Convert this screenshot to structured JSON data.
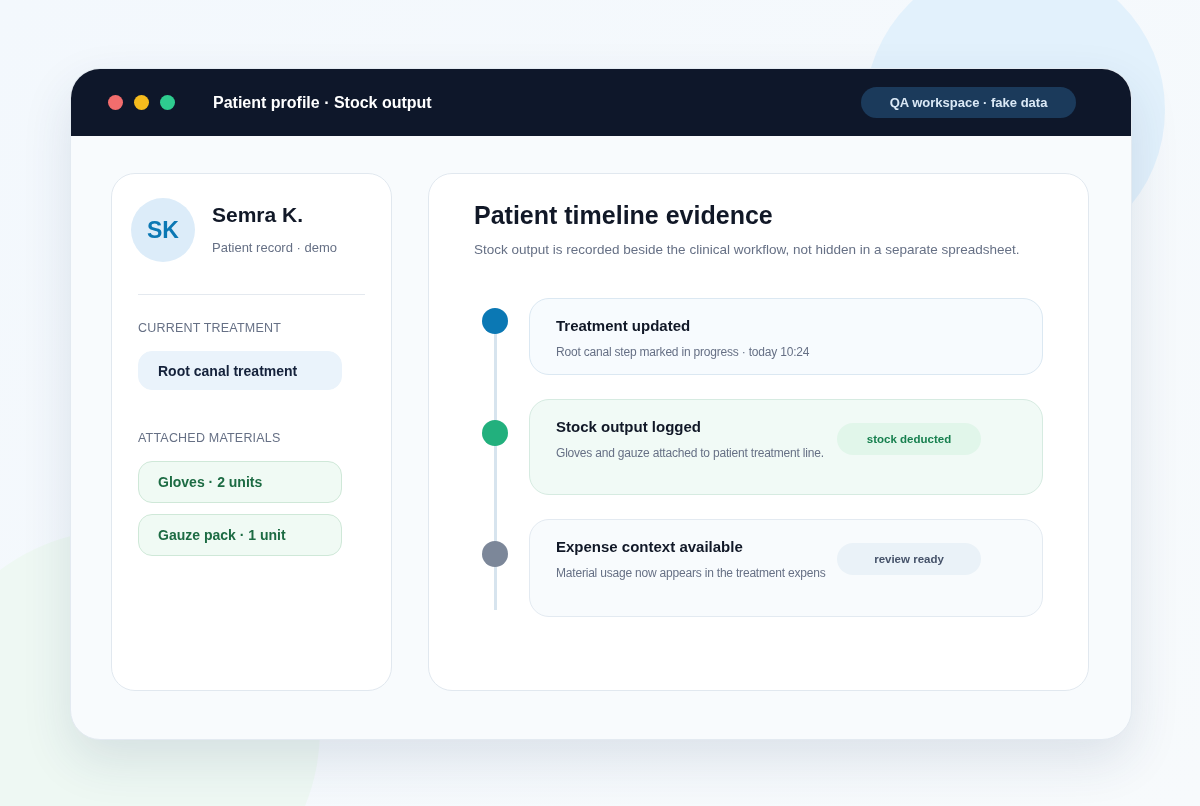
{
  "window": {
    "title": "Patient profile · Stock output",
    "badge": "QA workspace · fake data"
  },
  "patient": {
    "initials": "SK",
    "name": "Semra K.",
    "subtitle": "Patient record · demo"
  },
  "current_treatment": {
    "label": "CURRENT TREATMENT",
    "value": "Root canal treatment"
  },
  "attached_materials": {
    "label": "ATTACHED MATERIALS",
    "items": [
      "Gloves · 2 units",
      "Gauze pack · 1 unit"
    ]
  },
  "timeline": {
    "title": "Patient timeline evidence",
    "subtitle": "Stock output is recorded beside the clinical workflow, not hidden in a separate spreadsheet.",
    "events": [
      {
        "kind": "info",
        "color": "#0b78b4",
        "title": "Treatment updated",
        "text": "Root canal step marked in progress · today 10:24"
      },
      {
        "kind": "success",
        "color": "#22b07d",
        "title": "Stock output logged",
        "text": "Gloves and gauze attached to patient treatment line.",
        "badge": "stock deducted"
      },
      {
        "kind": "neutral",
        "color": "#7c8799",
        "title": "Expense context available",
        "text": "Material usage now appears in the treatment expens",
        "badge": "review ready"
      }
    ]
  }
}
